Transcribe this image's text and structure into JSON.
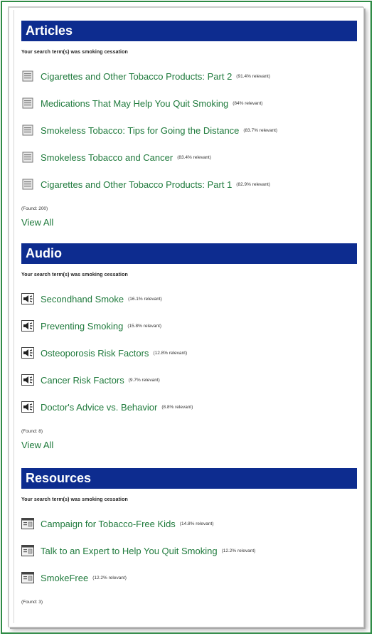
{
  "sections": [
    {
      "title": "Articles",
      "search_term": "Your search term(s) was smoking cessation",
      "icon": "document-icon",
      "items": [
        {
          "label": "Cigarettes and Other Tobacco Products: Part 2",
          "relevance": "(91.4% relevant)"
        },
        {
          "label": "Medications That May Help You Quit Smoking",
          "relevance": "(84% relevant)"
        },
        {
          "label": "Smokeless Tobacco: Tips for Going the Distance",
          "relevance": "(83.7% relevant)"
        },
        {
          "label": "Smokeless Tobacco and Cancer",
          "relevance": "(83.4% relevant)"
        },
        {
          "label": "Cigarettes and Other Tobacco Products: Part 1",
          "relevance": "(82.9% relevant)"
        }
      ],
      "found": "(Found: 200)",
      "view_all": "View All"
    },
    {
      "title": "Audio",
      "search_term": "Your search term(s) was smoking cessation",
      "icon": "speaker-icon",
      "items": [
        {
          "label": "Secondhand Smoke",
          "relevance": "(16.1% relevant)"
        },
        {
          "label": "Preventing Smoking",
          "relevance": "(15.8% relevant)"
        },
        {
          "label": "Osteoporosis Risk Factors",
          "relevance": "(12.8% relevant)"
        },
        {
          "label": "Cancer Risk Factors",
          "relevance": "(9.7% relevant)"
        },
        {
          "label": "Doctor's Advice vs. Behavior",
          "relevance": "(8.8% relevant)"
        }
      ],
      "found": "(Found: 8)",
      "view_all": "View All"
    },
    {
      "title": "Resources",
      "search_term": "Your search term(s) was smoking cessation",
      "icon": "window-icon",
      "items": [
        {
          "label": "Campaign for Tobacco-Free Kids",
          "relevance": "(14.8% relevant)"
        },
        {
          "label": "Talk to an Expert to Help You Quit Smoking",
          "relevance": "(12.2% relevant)"
        },
        {
          "label": "SmokeFree",
          "relevance": "(12.2% relevant)"
        }
      ],
      "found": "(Found: 3)"
    }
  ],
  "colors": {
    "header_bg": "#0d2c8f",
    "link": "#1f7a3c",
    "border": "#2e8b45"
  }
}
